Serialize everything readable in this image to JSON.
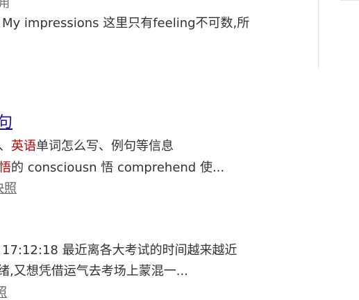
{
  "result1": {
    "partial_meta": "用",
    "snippet_line": "My impressions 这里只有feeling不可数,所"
  },
  "result2": {
    "title_fragment": "句",
    "snippet1_prefix": "、",
    "snippet1_hl": "英语",
    "snippet1_suffix": "单词怎么写、例句等信息",
    "snippet2_hl": "悟",
    "snippet2_suffix": "的 consciousn 悟 comprehend 使...",
    "snapshot_label": "快照"
  },
  "result3": {
    "snippet1": "17:12:18 最近离各大考试的时间越来越近",
    "snippet2": "绪,又想凭借运气去考场上蒙混一...",
    "snapshot_label": "照"
  }
}
